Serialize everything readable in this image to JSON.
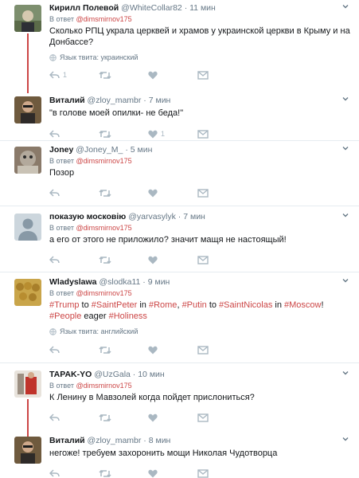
{
  "tweets": [
    {
      "fullname": "Кирилл Полевой",
      "handle": "@WhiteCollar82",
      "dot": "·",
      "time": "11 мин",
      "reply_prefix": "В ответ",
      "reply_to": "@dimsmirnov175",
      "text": "Сколько РПЦ украла церквей и храмов у украинской церкви в Крыму и на Донбассе?",
      "translate": "Язык твита: украинский",
      "reply_count": "1",
      "like_count": ""
    },
    {
      "fullname": "Виталий",
      "handle": "@zloy_mambr",
      "dot": "·",
      "time": "7 мин",
      "text": "\"в голове моей опилки- не беда!\"",
      "reply_count": "",
      "like_count": "1"
    },
    {
      "fullname": "Joney",
      "handle": "@Joney_M_",
      "dot": "·",
      "time": "5 мин",
      "reply_prefix": "В ответ",
      "reply_to": "@dimsmirnov175",
      "text": "Позор",
      "reply_count": "",
      "like_count": ""
    },
    {
      "fullname": "показую московію",
      "handle": "@yarvasylyk",
      "dot": "·",
      "time": "7 мин",
      "reply_prefix": "В ответ",
      "reply_to": "@dimsmirnov175",
      "text": "а его от этого не приложило? значит мащя не настоящый!",
      "reply_count": "",
      "like_count": ""
    },
    {
      "fullname": "Wladyslawa",
      "handle": "@slodka11",
      "dot": "·",
      "time": "9 мин",
      "reply_prefix": "В ответ",
      "reply_to": "@dimsmirnov175",
      "segments": [
        "#Trump",
        " to ",
        "#SaintPeter",
        " in ",
        "#Rome",
        ", ",
        "#Putin",
        " to ",
        "#SaintNicolas",
        " in ",
        "#Moscow",
        "! ",
        "#People",
        " eager ",
        "#Holiness"
      ],
      "translate": "Язык твита: английский",
      "reply_count": "",
      "like_count": ""
    },
    {
      "fullname": "TAPAK-YO",
      "handle": "@UzGala",
      "dot": "·",
      "time": "10 мин",
      "reply_prefix": "В ответ",
      "reply_to": "@dimsmirnov175",
      "text": "К Ленину в Мавзолей когда пойдет прислониться?",
      "reply_count": "",
      "like_count": ""
    },
    {
      "fullname": "Виталий",
      "handle": "@zloy_mambr",
      "dot": "·",
      "time": "8 мин",
      "text": "негоже! требуем захоронить мощи Николая Чудотворца",
      "reply_count": "",
      "like_count": ""
    }
  ],
  "icons": {
    "reply": "reply-icon",
    "retweet": "retweet-icon",
    "like": "heart-icon",
    "dm": "envelope-icon",
    "more": "caret-down-icon",
    "globe": "globe-icon"
  },
  "colors": {
    "accent": "#cc4646",
    "muted": "#657786",
    "icon": "#aab8c2",
    "border": "#e6ecf0"
  }
}
